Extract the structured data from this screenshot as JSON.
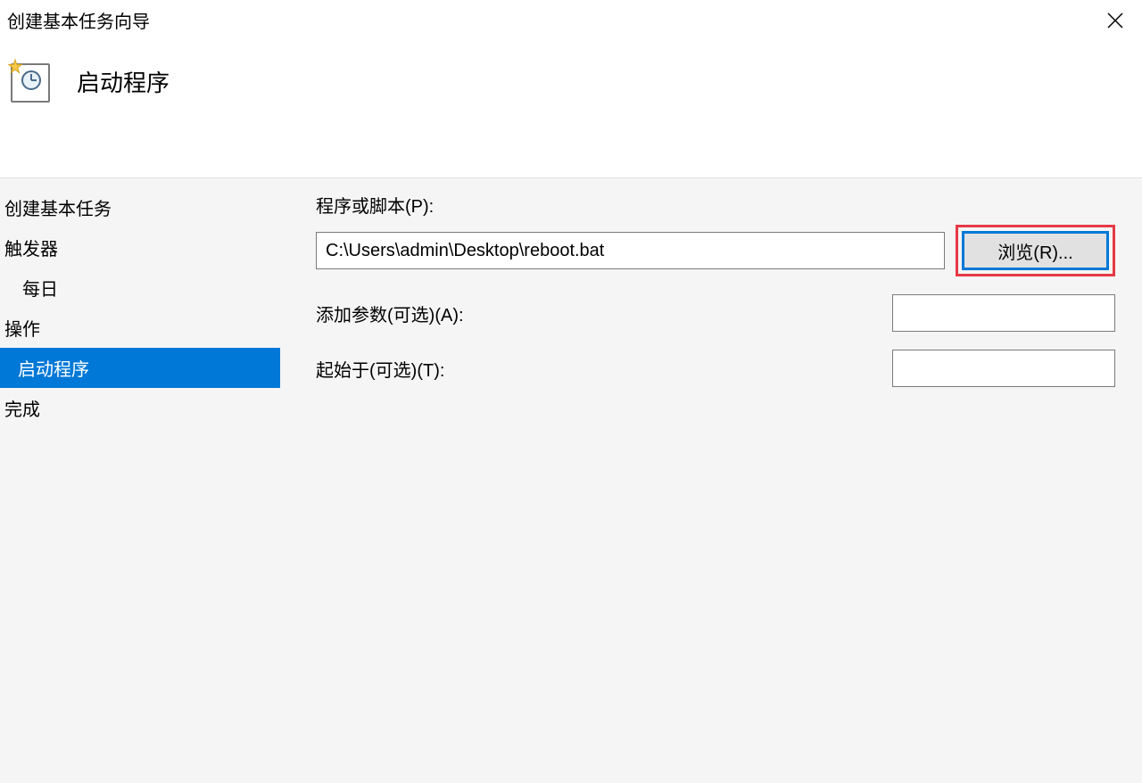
{
  "window": {
    "title": "创建基本任务向导"
  },
  "header": {
    "page_title": "启动程序"
  },
  "sidebar": {
    "items": [
      {
        "label": "创建基本任务",
        "selected": false,
        "indent": false
      },
      {
        "label": "触发器",
        "selected": false,
        "indent": false
      },
      {
        "label": "每日",
        "selected": false,
        "indent": true
      },
      {
        "label": "操作",
        "selected": false,
        "indent": false
      },
      {
        "label": "启动程序",
        "selected": true,
        "indent": true
      },
      {
        "label": "完成",
        "selected": false,
        "indent": false
      }
    ]
  },
  "form": {
    "program_label": "程序或脚本(P):",
    "program_value": "C:\\Users\\admin\\Desktop\\reboot.bat",
    "browse_label": "浏览(R)...",
    "arguments_label": "添加参数(可选)(A):",
    "arguments_value": "",
    "startin_label": "起始于(可选)(T):",
    "startin_value": ""
  }
}
